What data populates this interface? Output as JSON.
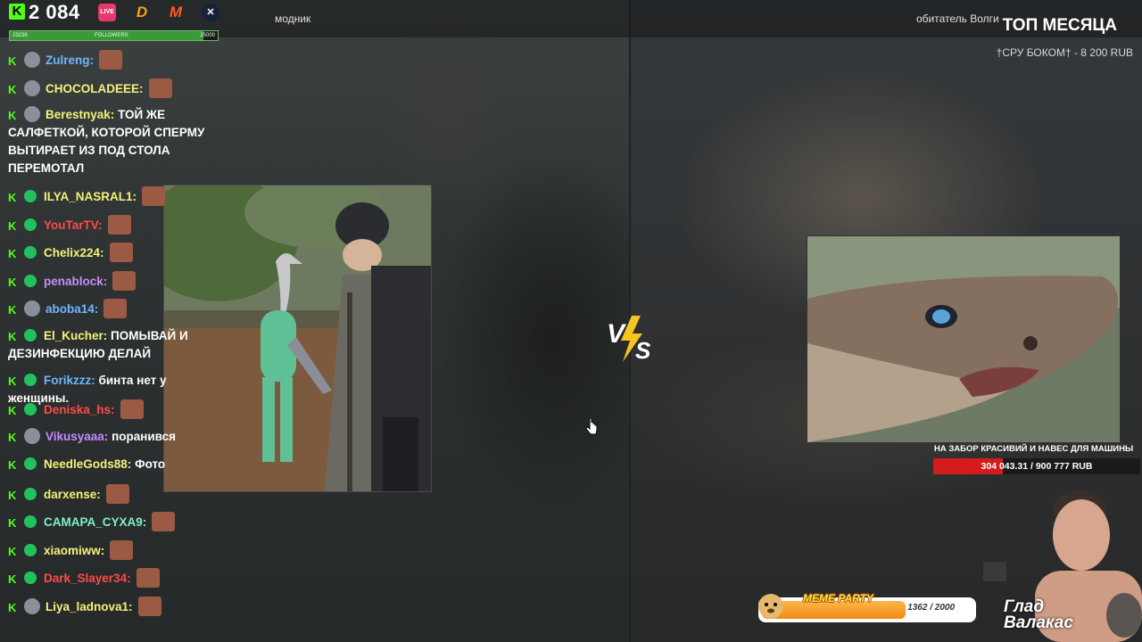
{
  "header": {
    "followers_count": "2 084",
    "follow_goal": {
      "current": "23238",
      "label": "FOLLOWERS",
      "target": "25000",
      "fraction": 0.93
    },
    "name_left": "модник",
    "name_right": "обитатель Волги",
    "top_month_title": "ТОП МЕСЯЦА",
    "top_donor": "†СРУ БОКОМ† - 8 200 RUB",
    "platform_icons": [
      "kick-icon",
      "live-icon",
      "donationalerts-icon",
      "memealerts-icon",
      "x-icon"
    ],
    "live_label": "LIVE",
    "d_label": "D",
    "m_label": "M",
    "x_label": "✕"
  },
  "chat": [
    {
      "user": "Zulreng:",
      "color": "#6fb7ff",
      "text": "",
      "badge": "kick",
      "avatar": true,
      "emote": true
    },
    {
      "user": "CHOCOLADEEE:",
      "color": "#f4f27a",
      "text": "",
      "badge": "kick",
      "avatar": true,
      "emote": true
    },
    {
      "user": "Berestnyak:",
      "color": "#f4f27a",
      "text": "ТОЙ ЖЕ САЛФЕТКОЙ, КОТОРОЙ СПЕРМУ ВЫТИРАЕТ ИЗ ПОД СТОЛА ПЕРЕМОТАЛ",
      "badge": "kick",
      "avatar": true,
      "emote": false
    },
    {
      "user": "ILYA_NASRAL1:",
      "color": "#f4f27a",
      "text": "",
      "badge": "sub",
      "avatar": false,
      "emote": true
    },
    {
      "user": "YouTarTV:",
      "color": "#ff4a4a",
      "text": "",
      "badge": "sub",
      "avatar": false,
      "emote": true
    },
    {
      "user": "Chelix224:",
      "color": "#f4f27a",
      "text": "",
      "badge": "sub",
      "avatar": false,
      "emote": true
    },
    {
      "user": "penablock:",
      "color": "#c58bff",
      "text": "",
      "badge": "sub",
      "avatar": false,
      "emote": true
    },
    {
      "user": "aboba14:",
      "color": "#6fb7ff",
      "text": "",
      "badge": "kick",
      "avatar": true,
      "emote": true
    },
    {
      "user": "El_Kucher:",
      "color": "#f4f27a",
      "text": "ПОМЫВАЙ И ДЕЗИНФЕКЦИЮ ДЕЛАЙ",
      "badge": "sub",
      "avatar": false,
      "emote": false
    },
    {
      "user": "Forikzzz:",
      "color": "#6fb7ff",
      "text": "бинта нет у женщины.",
      "badge": "sub",
      "avatar": false,
      "emote": false
    },
    {
      "user": "Deniska_hs:",
      "color": "#ff4a4a",
      "text": "",
      "badge": "sub",
      "avatar": false,
      "emote": true
    },
    {
      "user": "Vikusyaaa:",
      "color": "#c58bff",
      "text": "поранився",
      "badge": "kick",
      "avatar": true,
      "emote": false
    },
    {
      "user": "NeedleGods88:",
      "color": "#f4f27a",
      "text": "Фото",
      "badge": "sub",
      "avatar": false,
      "emote": false
    },
    {
      "user": "darxense:",
      "color": "#f4f27a",
      "text": "",
      "badge": "sub",
      "avatar": false,
      "emote": true
    },
    {
      "user": "CAMAPA_CYXA9:",
      "color": "#7ff0c4",
      "text": "",
      "badge": "sub",
      "avatar": false,
      "emote": true
    },
    {
      "user": "xiaomiww:",
      "color": "#f4f27a",
      "text": "",
      "badge": "sub",
      "avatar": false,
      "emote": true
    },
    {
      "user": "Dark_Slayer34:",
      "color": "#ff4a4a",
      "text": "",
      "badge": "sub",
      "avatar": false,
      "emote": true
    },
    {
      "user": "Liya_ladnova1:",
      "color": "#f4f27a",
      "text": "",
      "badge": "kick",
      "avatar": true,
      "emote": true
    }
  ],
  "vs_label": "VS",
  "donation_goal": {
    "title": "НА ЗАБОР КРАСИВИЙ И НАВЕС ДЛЯ МАШИНЫ",
    "progress_text": "304 043.31 / 900 777 RUB",
    "fraction": 0.3375
  },
  "meme_party": {
    "title": "MEME PARTY",
    "count_text": "1362 / 2000",
    "fraction": 0.681
  },
  "streamer_name": "Глад Валакас"
}
